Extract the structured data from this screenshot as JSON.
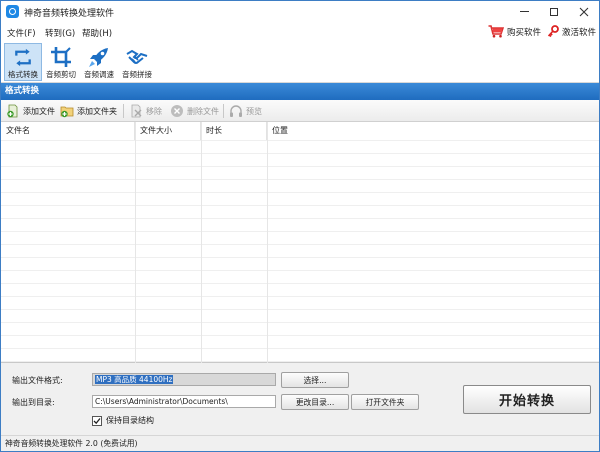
{
  "window": {
    "title": "神奇音频转换处理软件"
  },
  "menu": {
    "file": "文件(F)",
    "goto": "转到(G)",
    "help": "帮助(H)",
    "buy": "购买软件",
    "activate": "激活软件"
  },
  "toolbar": {
    "items": [
      {
        "label": "格式转换",
        "icon": "convert-icon",
        "active": true
      },
      {
        "label": "音频剪切",
        "icon": "crop-icon",
        "active": false
      },
      {
        "label": "音频调速",
        "icon": "rocket-icon",
        "active": false
      },
      {
        "label": "音频拼接",
        "icon": "handshake-icon",
        "active": false
      }
    ]
  },
  "section": {
    "title": "格式转换"
  },
  "actions": {
    "add_file": "添加文件",
    "add_folder": "添加文件夹",
    "remove": "移除",
    "delete_file": "删除文件",
    "preview": "预览"
  },
  "table": {
    "columns": [
      "文件名",
      "文件大小",
      "时长",
      "位置"
    ],
    "rows": []
  },
  "output": {
    "format_label": "输出文件格式:",
    "format_value": "MP3 高品质 44100Hz",
    "choose_button": "选择...",
    "dir_label": "输出到目录:",
    "dir_value": "C:\\Users\\Administrator\\Documents\\",
    "change_dir_button": "更改目录...",
    "open_folder_button": "打开文件夹",
    "keep_structure_label": "保持目录结构",
    "keep_structure_checked": true,
    "start_button": "开始转换"
  },
  "status": {
    "text": "神奇音频转换处理软件 2.0 (免费试用)"
  },
  "colors": {
    "accent": "#1f6cbf",
    "section_header": "#2f7bcb",
    "selection": "#2f6fc0"
  }
}
